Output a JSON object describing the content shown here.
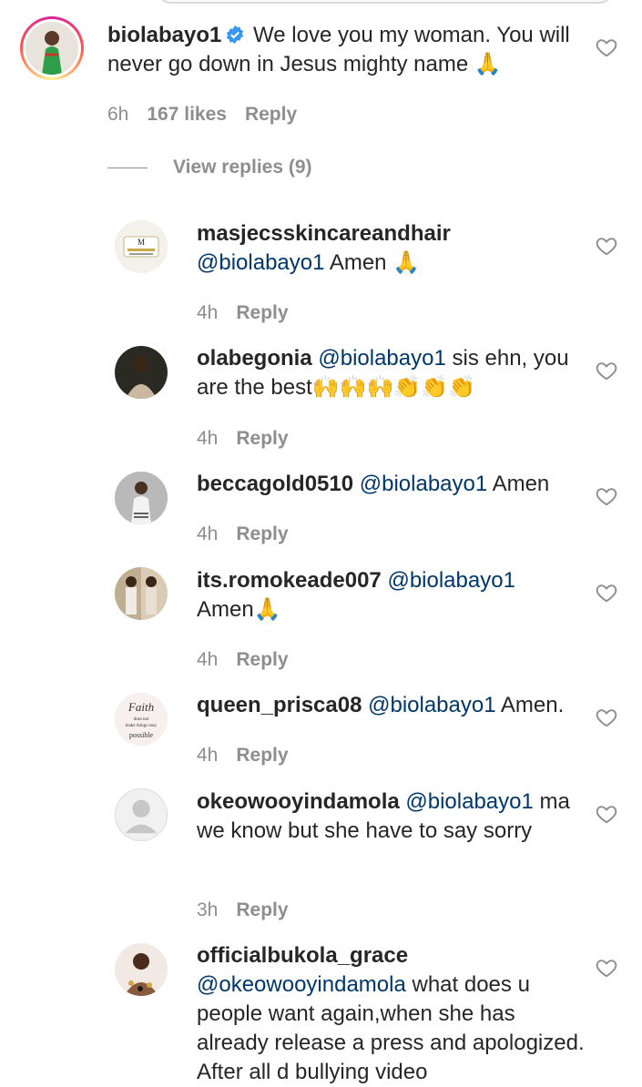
{
  "comments": [
    {
      "username": "biolabayo1",
      "verified": true,
      "text": "We love you my woman. You will never go down in Jesus mighty name 🙏",
      "time": "6h",
      "likes": "167 likes",
      "reply_label": "Reply",
      "view_replies": "View replies (9)"
    },
    {
      "username": "masjecsskincareandhair",
      "mention": "@biolabayo1",
      "text": "Amen 🙏",
      "time": "4h",
      "reply_label": "Reply"
    },
    {
      "username": "olabegonia",
      "mention": "@biolabayo1",
      "text": "sis ehn, you are the best🙌🙌🙌👏👏👏",
      "time": "4h",
      "reply_label": "Reply"
    },
    {
      "username": "beccagold0510",
      "mention": "@biolabayo1",
      "text": "Amen",
      "time": "4h",
      "reply_label": "Reply"
    },
    {
      "username": "its.romokeade007",
      "mention": "@biolabayo1",
      "text": "Amen🙏",
      "time": "4h",
      "reply_label": "Reply"
    },
    {
      "username": "queen_prisca08",
      "mention": "@biolabayo1",
      "text": "Amen.",
      "time": "4h",
      "reply_label": "Reply"
    },
    {
      "username": "okeowooyindamola",
      "mention": "@biolabayo1",
      "text": "ma we know but she have to say sorry",
      "time": "3h",
      "reply_label": "Reply"
    },
    {
      "username": "officialbukola_grace",
      "mention": "@okeowooyindamola",
      "text": "what does u people want again,when she has already release a press and apologized. After all d bullying video",
      "time": "",
      "reply_label": ""
    }
  ],
  "avatars": {
    "queen_prisca08_text": "Faith does not make things easy it makes them possible"
  },
  "colors": {
    "mention": "#00376b",
    "meta": "#8e8e8e",
    "verified": "#3897f0"
  }
}
